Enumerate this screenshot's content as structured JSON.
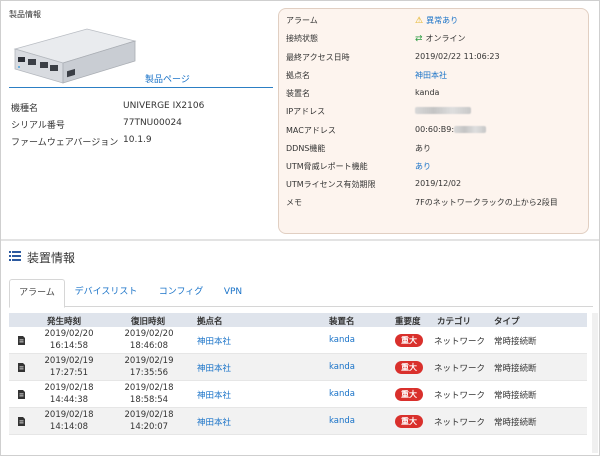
{
  "product": {
    "title": "製品情報",
    "product_page_link": "製品ページ",
    "specs": [
      {
        "label": "機種名",
        "value": "UNIVERGE IX2106"
      },
      {
        "label": "シリアル番号",
        "value": "77TNU00024"
      },
      {
        "label": "ファームウェアバージョン",
        "value": "10.1.9"
      }
    ]
  },
  "status": {
    "rows": [
      {
        "label": "アラーム",
        "value": "異常あり",
        "icon": "warning-icon",
        "style": "link"
      },
      {
        "label": "接続状態",
        "value": "オンライン",
        "icon": "sync-icon",
        "style": "plain"
      },
      {
        "label": "最終アクセス日時",
        "value": "2019/02/22 11:06:23",
        "style": "plain"
      },
      {
        "label": "拠点名",
        "value": "神田本社",
        "style": "link"
      },
      {
        "label": "装置名",
        "value": "kanda",
        "style": "plain"
      },
      {
        "label": "IPアドレス",
        "value": "",
        "style": "blur"
      },
      {
        "label": "MACアドレス",
        "value": "00:60:B9:",
        "style": "mac"
      },
      {
        "label": "DDNS機能",
        "value": "あり",
        "style": "plain"
      },
      {
        "label": "UTM脅威レポート機能",
        "value": "あり",
        "style": "link"
      },
      {
        "label": "UTMライセンス有効期限",
        "value": "2019/12/02",
        "style": "plain"
      },
      {
        "label": "メモ",
        "value": "7Fのネットワークラックの上から2段目",
        "style": "plain"
      }
    ],
    "colors": {
      "panel_bg": "#fdf4ee",
      "link": "#1a73c8",
      "warning": "#e0a800",
      "online": "#2e9d44"
    }
  },
  "device_info": {
    "title": "装置情報",
    "tabs": [
      "アラーム",
      "デバイスリスト",
      "コンフィグ",
      "VPN"
    ],
    "active_tab": "アラーム",
    "columns": [
      "発生時刻",
      "復旧時刻",
      "拠点名",
      "装置名",
      "重要度",
      "カテゴリ",
      "タイプ"
    ],
    "rows": [
      {
        "occurred_date": "2019/02/20",
        "occurred_time": "16:14:58",
        "recovered_date": "2019/02/20",
        "recovered_time": "18:46:08",
        "site": "神田本社",
        "device": "kanda",
        "severity": "重大",
        "category": "ネットワーク",
        "type": "常時接続断"
      },
      {
        "occurred_date": "2019/02/19",
        "occurred_time": "17:27:51",
        "recovered_date": "2019/02/19",
        "recovered_time": "17:35:56",
        "site": "神田本社",
        "device": "kanda",
        "severity": "重大",
        "category": "ネットワーク",
        "type": "常時接続断"
      },
      {
        "occurred_date": "2019/02/18",
        "occurred_time": "14:44:38",
        "recovered_date": "2019/02/18",
        "recovered_time": "18:58:54",
        "site": "神田本社",
        "device": "kanda",
        "severity": "重大",
        "category": "ネットワーク",
        "type": "常時接続断"
      },
      {
        "occurred_date": "2019/02/18",
        "occurred_time": "14:14:08",
        "recovered_date": "2019/02/18",
        "recovered_time": "14:20:07",
        "site": "神田本社",
        "device": "kanda",
        "severity": "重大",
        "category": "ネットワーク",
        "type": "常時接続断"
      }
    ],
    "severity_color": "#d9302c"
  }
}
